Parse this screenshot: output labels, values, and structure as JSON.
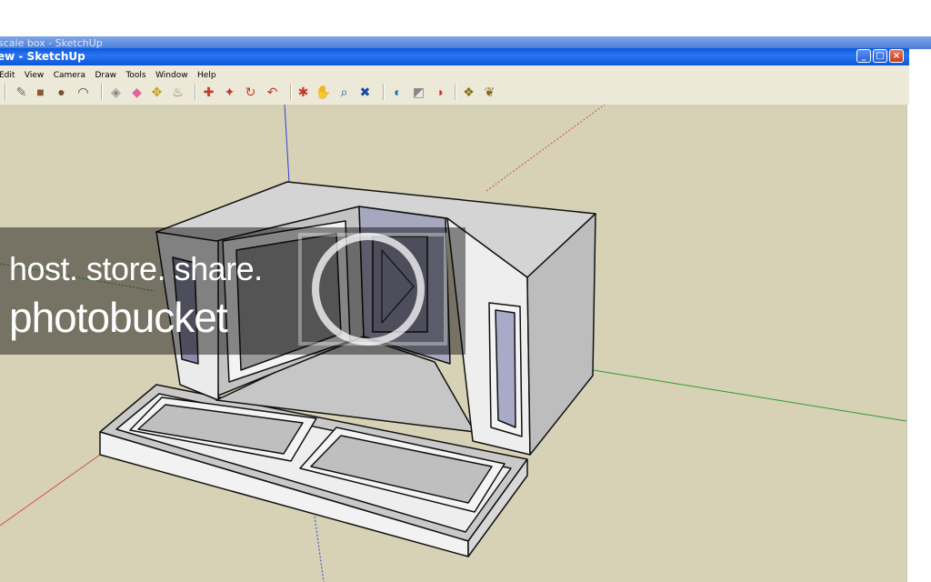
{
  "window": {
    "ghost_title": "scale box - SketchUp",
    "title": "ew - SketchUp",
    "controls": {
      "minimize": "_",
      "maximize": "□",
      "close": "×"
    }
  },
  "menu": [
    "Edit",
    "View",
    "Camera",
    "Draw",
    "Tools",
    "Window",
    "Help"
  ],
  "toolbar": [
    {
      "icon": "pencil-icon",
      "glyph": "✎",
      "color": "#6d6d6d"
    },
    {
      "icon": "rectangle-icon",
      "glyph": "■",
      "color": "#8a5a2b"
    },
    {
      "icon": "circle-icon",
      "glyph": "●",
      "color": "#7a5230"
    },
    {
      "icon": "arc-icon",
      "glyph": "◠",
      "color": "#333333"
    },
    {
      "icon": "push-pull-icon",
      "glyph": "◈",
      "color": "#888888"
    },
    {
      "icon": "eraser-icon",
      "glyph": "◆",
      "color": "#e0649b"
    },
    {
      "icon": "tape-measure-icon",
      "glyph": "✥",
      "color": "#c49a12"
    },
    {
      "icon": "paint-bucket-icon",
      "glyph": "♨",
      "color": "#8d6b3a"
    },
    {
      "icon": "move-icon",
      "glyph": "✚",
      "color": "#c0392b"
    },
    {
      "icon": "rotate-icon",
      "glyph": "✦",
      "color": "#c0392b"
    },
    {
      "icon": "follow-me-icon",
      "glyph": "↻",
      "color": "#c0392b"
    },
    {
      "icon": "offset-icon",
      "glyph": "↶",
      "color": "#c0392b"
    },
    {
      "icon": "orbit-icon",
      "glyph": "✱",
      "color": "#c0392b"
    },
    {
      "icon": "pan-icon",
      "glyph": "✋",
      "color": "#555555"
    },
    {
      "icon": "zoom-icon",
      "glyph": "⌕",
      "color": "#1a4aa0"
    },
    {
      "icon": "zoom-extents-icon",
      "glyph": "✖",
      "color": "#1a4aa0"
    },
    {
      "icon": "previous-view-icon",
      "glyph": "◐",
      "color": "#1a6ab0"
    },
    {
      "icon": "next-view-icon",
      "glyph": "◩",
      "color": "#888888"
    },
    {
      "icon": "google-earth-icon",
      "glyph": "◑",
      "color": "#c0392b"
    },
    {
      "icon": "get-models-icon",
      "glyph": "❖",
      "color": "#8a6d1a"
    },
    {
      "icon": "share-model-icon",
      "glyph": "❦",
      "color": "#8a6d1a"
    }
  ],
  "watermark": {
    "line1": "host. store. share.",
    "line2": "photobucket"
  },
  "colors": {
    "viewport_bg": "#d7d2b6",
    "axis_red": "#d44d4d",
    "axis_green": "#2e9b2e",
    "axis_blue": "#2b3fd6"
  }
}
